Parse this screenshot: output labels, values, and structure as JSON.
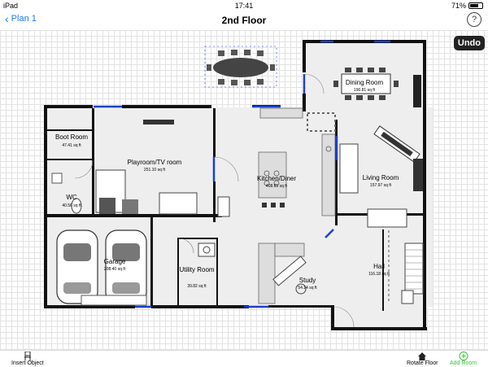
{
  "status": {
    "device": "iPad",
    "time": "17:41",
    "battery": "71%",
    "battery_level": 0.71
  },
  "nav": {
    "back_label": "Plan 1",
    "title": "2nd Floor",
    "help": "?"
  },
  "undo_label": "Undo",
  "rooms": [
    {
      "id": "boot",
      "name": "Boot Room",
      "area": "47.41 sq ft"
    },
    {
      "id": "wc",
      "name": "WC",
      "area": "40.56 sq ft"
    },
    {
      "id": "playroom",
      "name": "Playroom/TV room",
      "area": "251.10 sq ft"
    },
    {
      "id": "kitchen",
      "name": "Kitchen/Diner",
      "area": "408.65 sq ft"
    },
    {
      "id": "dining",
      "name": "Dining Room",
      "area": "190.81 sq ft"
    },
    {
      "id": "living",
      "name": "Living Room",
      "area": "157.97 sq ft"
    },
    {
      "id": "garage",
      "name": "Garage",
      "area": "208.40 sq ft"
    },
    {
      "id": "utility",
      "name": "Utility Room",
      "area": "39.82 sq ft"
    },
    {
      "id": "study",
      "name": "Study",
      "area": "54.14 sq ft"
    },
    {
      "id": "hall",
      "name": "Hall",
      "area": "116.18 sq ft"
    }
  ],
  "toolbar": {
    "insert_object": "Insert Object",
    "rotate_floor": "Rotate Floor",
    "add_room": "Add Room",
    "add_color": "#3bbf3b"
  },
  "colors": {
    "link": "#1a7cf0",
    "wall": "#111111",
    "door": "#1a3fcf"
  }
}
